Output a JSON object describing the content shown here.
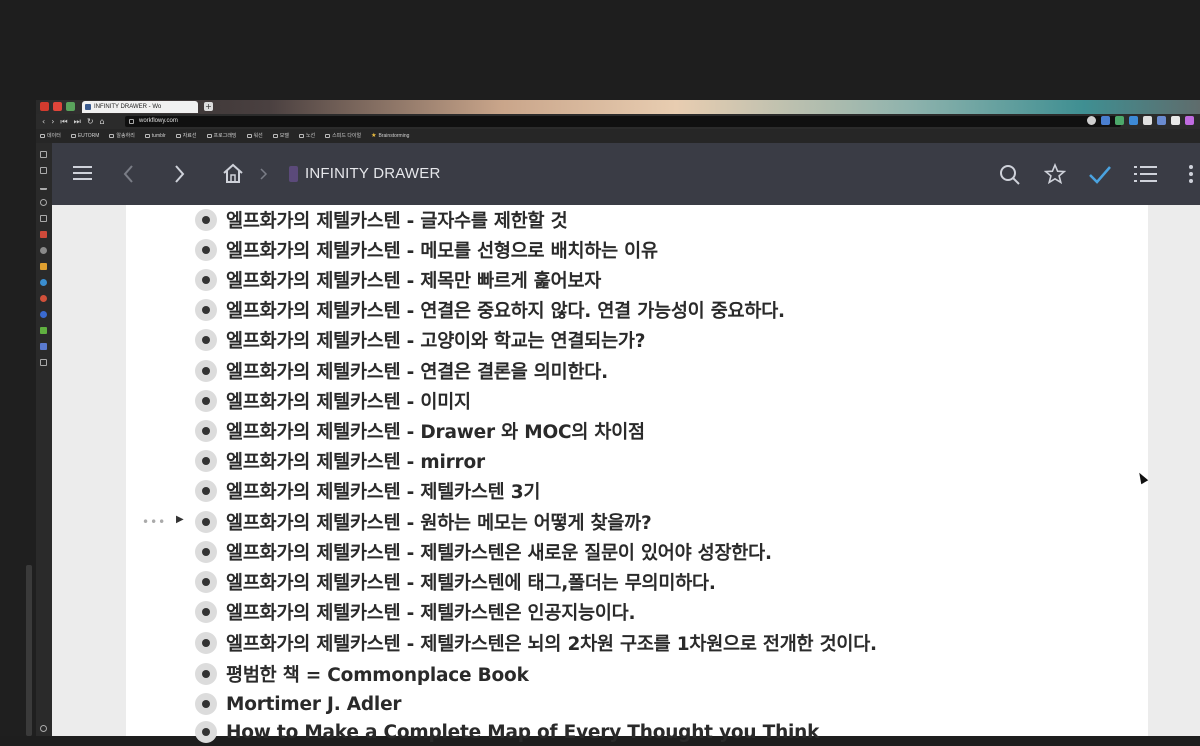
{
  "browser": {
    "tab_title": "INFINITY DRAWER - Wo",
    "new_tab_label": "+",
    "url": "workflowy.com",
    "bookmarks": [
      "데이터",
      "EUTORM",
      "알송하리",
      "tumblr",
      "자료선",
      "프로그래밍",
      "워선",
      "모델",
      "노선",
      "스피드 다이얼",
      "Brainstorming"
    ]
  },
  "header": {
    "title": "INFINITY DRAWER",
    "icons": [
      "menu-icon",
      "back-icon",
      "forward-icon",
      "home-icon",
      "search-icon",
      "star-icon",
      "check-icon",
      "list-icon",
      "more-icon"
    ]
  },
  "items": [
    "엘프화가의 제텔카스텐 - 글자수를 제한할 것",
    "엘프화가의 제텔카스텐 - 메모를 선형으로 배치하는 이유",
    "엘프화가의 제텔카스텐 - 제목만 빠르게 훑어보자",
    "엘프화가의 제텔카스텐 - 연결은 중요하지 않다. 연결 가능성이 중요하다.",
    "엘프화가의 제텔카스텐 - 고양이와 학교는 연결되는가?",
    "엘프화가의 제텔카스텐 - 연결은 결론을 의미한다.",
    "엘프화가의 제텔카스텐 - 이미지",
    "엘프화가의 제텔카스텐 - Drawer 와 MOC의 차이점",
    "엘프화가의 제텔카스텐 - mirror",
    "엘프화가의 제텔카스텐 - 제텔카스텐 3기",
    "엘프화가의 제텔카스텐 - 원하는 메모는 어떻게 찾을까?",
    "엘프화가의 제텔카스텐 - 제텔카스텐은 새로운 질문이 있어야 성장한다.",
    "엘프화가의 제텔카스텐 - 제텔카스텐에 태그,폴더는 무의미하다.",
    "엘프화가의 제텔카스텐 - 제텔카스텐은 인공지능이다.",
    "엘프화가의 제텔카스텐 - 제텔카스텐은 뇌의 2차원 구조를 1차원으로 전개한 것이다.",
    "평범한 책 = Commonplace Book",
    "Mortimer J. Adler",
    "How to Make a Complete Map of Every Thought you Think"
  ]
}
